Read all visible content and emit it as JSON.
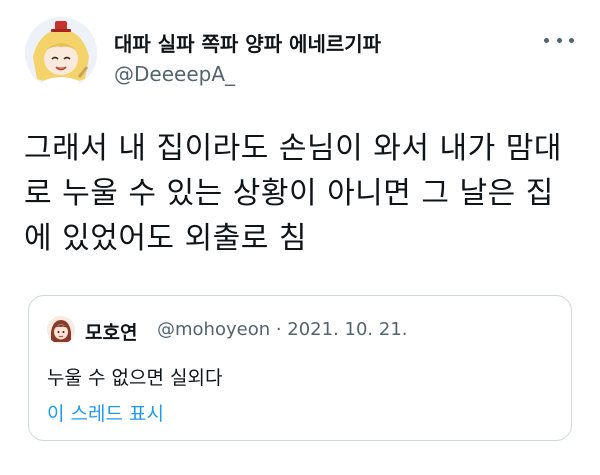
{
  "tweet": {
    "display_name": "대파 실파 쪽파 양파 에네르기파",
    "handle": "@DeeeepA_",
    "text_lines": [
      "그래서 내 집이라도 손님이 와서 내가 맘대",
      "로 누울 수 있는 상황이 아니면 그 날은 집",
      "에 있었어도 외출로 침"
    ]
  },
  "quoted_tweet": {
    "display_name": "모호연",
    "handle_and_date": "@mohoyeon · 2021. 10. 21.",
    "text": "누울 수 없으면 실외다",
    "show_thread_label": "이 스레드 표시"
  },
  "icons": {
    "more": "more-horizontal-icon"
  },
  "colors": {
    "text_primary": "#0f1419",
    "text_secondary": "#536471",
    "link": "#1d9bf0",
    "border": "#cfd9de"
  }
}
